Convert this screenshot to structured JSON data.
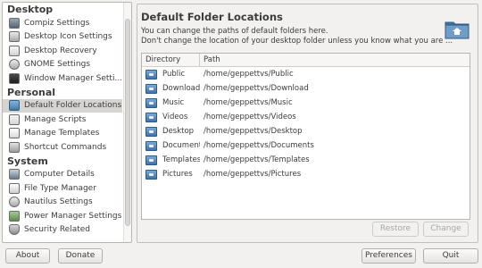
{
  "sidebar": {
    "groups": [
      {
        "label": "Desktop",
        "items": [
          {
            "label": "Compiz Settings",
            "icon": "compiz-icon"
          },
          {
            "label": "Desktop Icon Settings",
            "icon": "desktop-icons-icon"
          },
          {
            "label": "Desktop Recovery",
            "icon": "recovery-icon"
          },
          {
            "label": "GNOME Settings",
            "icon": "gnome-icon"
          },
          {
            "label": "Window Manager Setti...",
            "icon": "window-manager-icon"
          }
        ]
      },
      {
        "label": "Personal",
        "items": [
          {
            "label": "Default Folder Locations",
            "icon": "folder-icon",
            "selected": true
          },
          {
            "label": "Manage Scripts",
            "icon": "scripts-icon"
          },
          {
            "label": "Manage Templates",
            "icon": "templates-icon"
          },
          {
            "label": "Shortcut Commands",
            "icon": "shortcut-icon"
          }
        ]
      },
      {
        "label": "System",
        "items": [
          {
            "label": "Computer Details",
            "icon": "computer-icon"
          },
          {
            "label": "File Type Manager",
            "icon": "file-type-icon"
          },
          {
            "label": "Nautilus Settings",
            "icon": "nautilus-icon"
          },
          {
            "label": "Power Manager Settings",
            "icon": "power-icon"
          },
          {
            "label": "Security Related",
            "icon": "security-icon"
          }
        ]
      }
    ]
  },
  "main": {
    "title": "Default Folder Locations",
    "desc_line1": "You can change the paths of default folders here.",
    "desc_line2": "Don't change the location of your desktop folder unless you know what you are ...",
    "hero_icon": "home-folder-icon",
    "table": {
      "headers": {
        "directory": "Directory",
        "path": "Path"
      },
      "rows": [
        {
          "directory": "Public",
          "path": "/home/geppettvs/Public"
        },
        {
          "directory": "Download",
          "path": "/home/geppettvs/Download"
        },
        {
          "directory": "Music",
          "path": "/home/geppettvs/Music"
        },
        {
          "directory": "Videos",
          "path": "/home/geppettvs/Videos"
        },
        {
          "directory": "Desktop",
          "path": "/home/geppettvs/Desktop"
        },
        {
          "directory": "Document",
          "path": "/home/geppettvs/Documents"
        },
        {
          "directory": "Templates",
          "path": "/home/geppettvs/Templates"
        },
        {
          "directory": "Pictures",
          "path": "/home/geppettvs/Pictures"
        }
      ]
    },
    "restore_label": "Restore",
    "change_label": "Change"
  },
  "footer": {
    "about_label": "About",
    "donate_label": "Donate",
    "preferences_label": "Preferences",
    "quit_label": "Quit"
  },
  "colors": {
    "window_bg": "#f2f1f0",
    "selection": "#d6d4d1",
    "folder_blue": "#3e75a6"
  }
}
